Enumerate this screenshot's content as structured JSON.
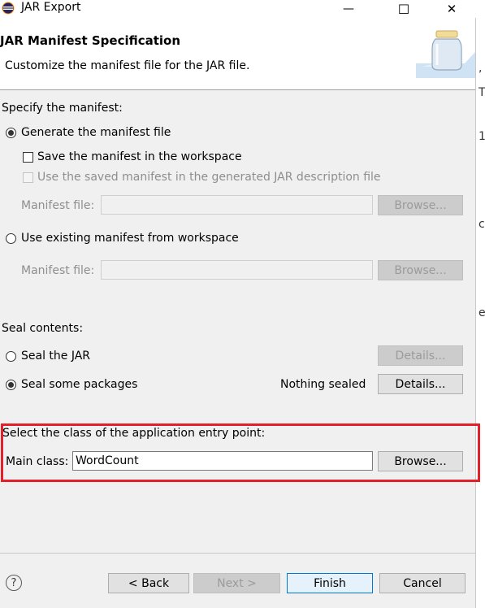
{
  "window": {
    "title": "JAR Export",
    "minimize": "—",
    "maximize": "☐",
    "close": "✕"
  },
  "header": {
    "title": "JAR Manifest Specification",
    "description": "Customize the manifest file for the JAR file."
  },
  "manifest": {
    "section_label": "Specify the manifest:",
    "generate_label": "Generate the manifest file",
    "save_label": "Save the manifest in the workspace",
    "use_saved_label": "Use the saved manifest in the generated JAR description file",
    "manifest_file_label_1": "Manifest file:",
    "browse_1": "Browse...",
    "use_existing_label": "Use existing manifest from workspace",
    "manifest_file_label_2": "Manifest file:",
    "browse_2": "Browse..."
  },
  "seal": {
    "section_label": "Seal contents:",
    "seal_jar_label": "Seal the JAR",
    "details_1": "Details...",
    "seal_some_label": "Seal some packages",
    "nothing_sealed": "Nothing sealed",
    "details_2": "Details..."
  },
  "entry": {
    "section_label": "Select the class of the application entry point:",
    "main_class_label": "Main class:",
    "main_class_value": "WordCount",
    "browse": "Browse..."
  },
  "footer": {
    "help": "?",
    "back": "< Back",
    "next": "Next >",
    "finish": "Finish",
    "cancel": "Cancel"
  },
  "background_editor": {
    "chars": [
      ",",
      "T",
      "1",
      "c",
      "e"
    ]
  },
  "colors": {
    "highlight": "#e31f2a",
    "panel": "#f0f0f0",
    "focus": "#0078d7"
  }
}
